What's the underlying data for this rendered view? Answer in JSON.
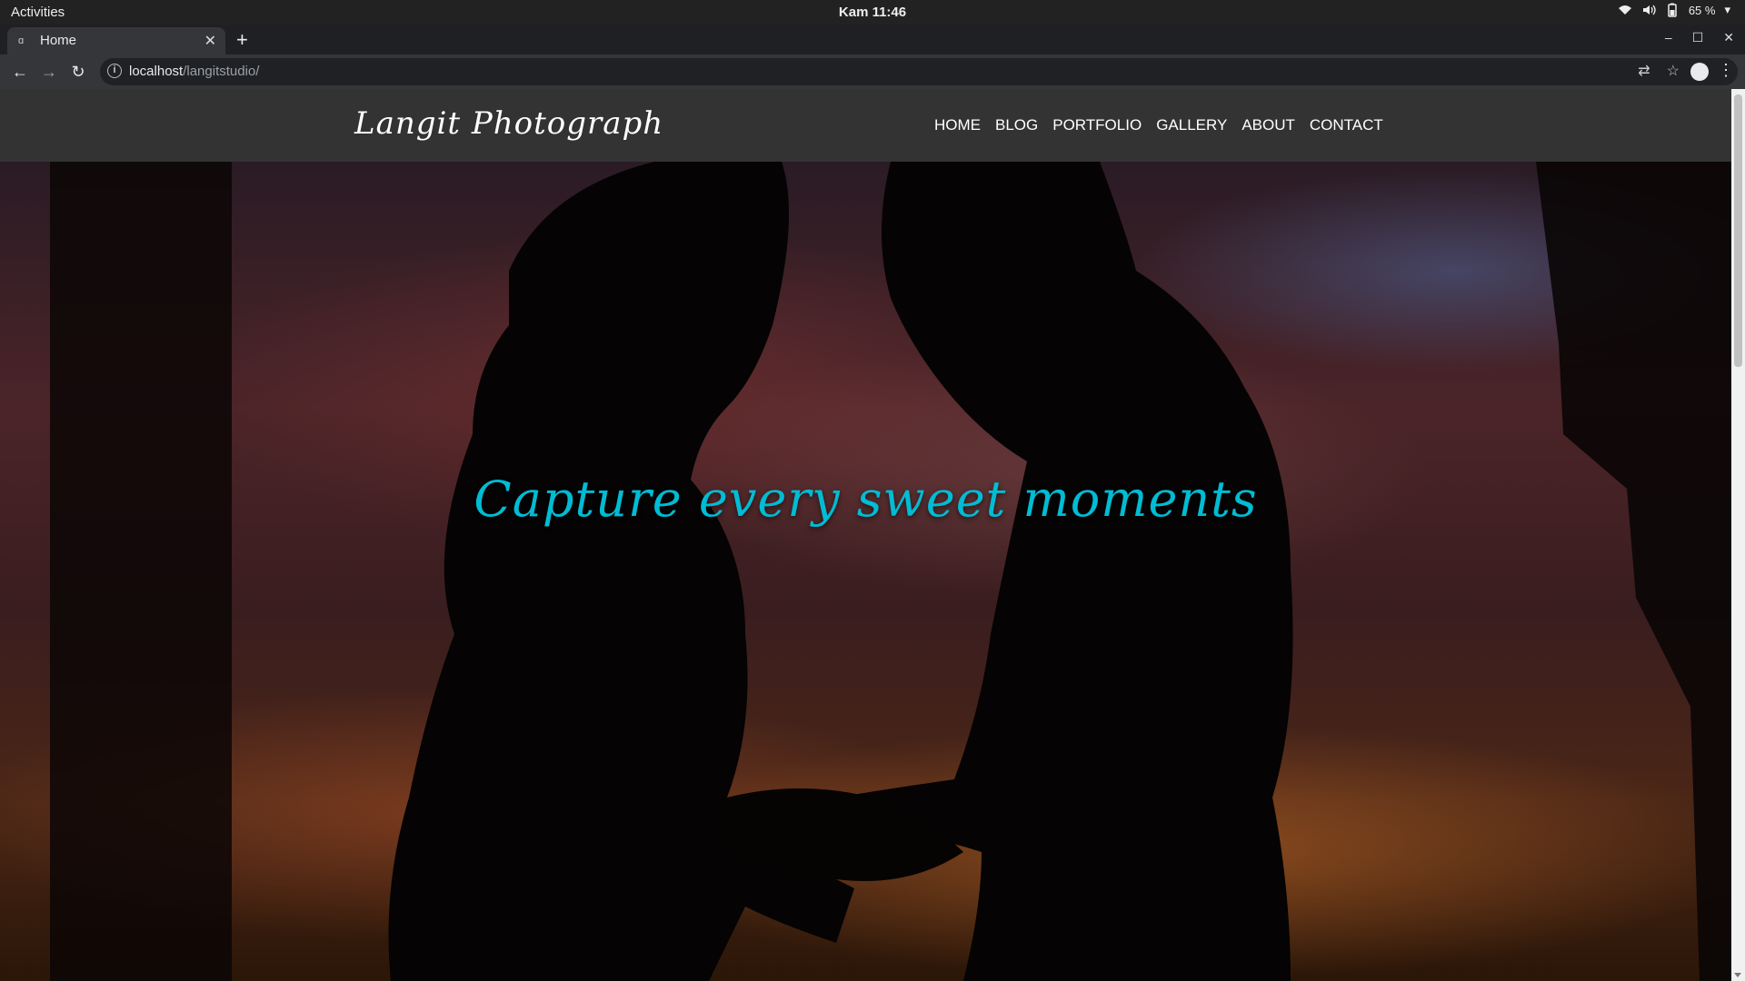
{
  "system": {
    "activities": "Activities",
    "clock": "Kam 11:46",
    "battery": "65 %"
  },
  "browser": {
    "tab_title": "Home",
    "url_host": "localhost",
    "url_path": "/langitstudio/"
  },
  "site": {
    "brand": "Langit Photograph",
    "nav": [
      "HOME",
      "BLOG",
      "PORTFOLIO",
      "GALLERY",
      "ABOUT",
      "CONTACT"
    ],
    "hero_title": "Capture every sweet moments",
    "colors": {
      "header_bg": "#333333",
      "hero_title": "#00bcd4"
    }
  }
}
